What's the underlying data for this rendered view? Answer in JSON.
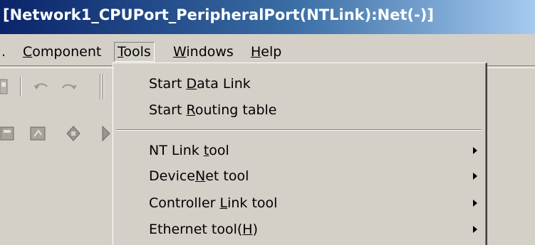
{
  "window": {
    "title": "[Network1_CPUPort_PeripheralPort(NTLink):Net(-)]"
  },
  "menubar": {
    "items": [
      {
        "label_prefix": ".",
        "label": ""
      },
      {
        "label_accel": "C",
        "label_rest": "omponent"
      },
      {
        "label_accel": "T",
        "label_rest": "ools"
      },
      {
        "label_accel": "W",
        "label_rest": "indows"
      },
      {
        "label_accel": "H",
        "label_rest": "elp"
      }
    ]
  },
  "tools_menu": {
    "items": [
      {
        "pre": "Start ",
        "accel": "D",
        "post": "ata Link",
        "submenu": false
      },
      {
        "pre": "Start ",
        "accel": "R",
        "post": "outing table",
        "submenu": false
      },
      {
        "pre": "NT Link ",
        "accel": "t",
        "post": "ool",
        "submenu": true
      },
      {
        "pre": "Device",
        "accel": "N",
        "post": "et tool",
        "submenu": true
      },
      {
        "pre": "Controller ",
        "accel": "L",
        "post": "ink tool",
        "submenu": true
      },
      {
        "pre": "Ethernet tool(",
        "accel": "H",
        "post": ")",
        "submenu": true
      }
    ]
  },
  "icons": {
    "undo": "undo-icon",
    "redo": "redo-icon"
  }
}
